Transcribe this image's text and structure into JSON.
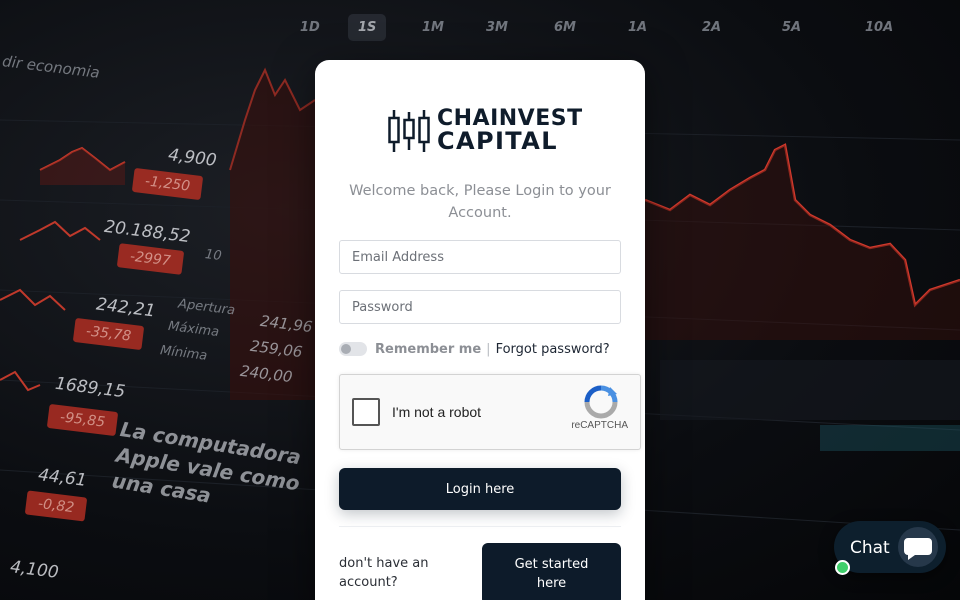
{
  "background": {
    "timeframes": [
      "1D",
      "1S",
      "1M",
      "3M",
      "6M",
      "1A",
      "2A",
      "5A",
      "10A"
    ],
    "active_timeframe": "1S",
    "caption": "dir economia",
    "values": [
      "4,900",
      "20.188,52",
      "242,21",
      "1689,15",
      "44,61",
      "4,100"
    ],
    "changes": [
      "-1,250",
      "-2997",
      "-35,78",
      "-95,85",
      "-0,82"
    ],
    "labels": [
      "10",
      "Apertura",
      "Máxima",
      "Mínima",
      "241,96",
      "259,06",
      "240,00"
    ],
    "headline": "La computadora Apple vale como una casa",
    "accent_red": "#b02e23"
  },
  "brand": {
    "line1": "CHAINVEST",
    "line2": "CAPITAL",
    "color": "#0f1c2b"
  },
  "login": {
    "welcome": "Welcome back, Please Login to your Account.",
    "email_placeholder": "Email Address",
    "password_placeholder": "Password",
    "remember_label": "Remember me",
    "separator": "|",
    "forgot_label": "Forgot password?",
    "recaptcha_label": "I'm not a robot",
    "recaptcha_brand": "reCAPTCHA",
    "login_button": "Login here",
    "no_account": "don't have an account?",
    "get_started_button": "Get started here",
    "primary_color": "#0d1b2a"
  },
  "chat": {
    "label": "Chat",
    "status_color": "#3fcf6b"
  }
}
